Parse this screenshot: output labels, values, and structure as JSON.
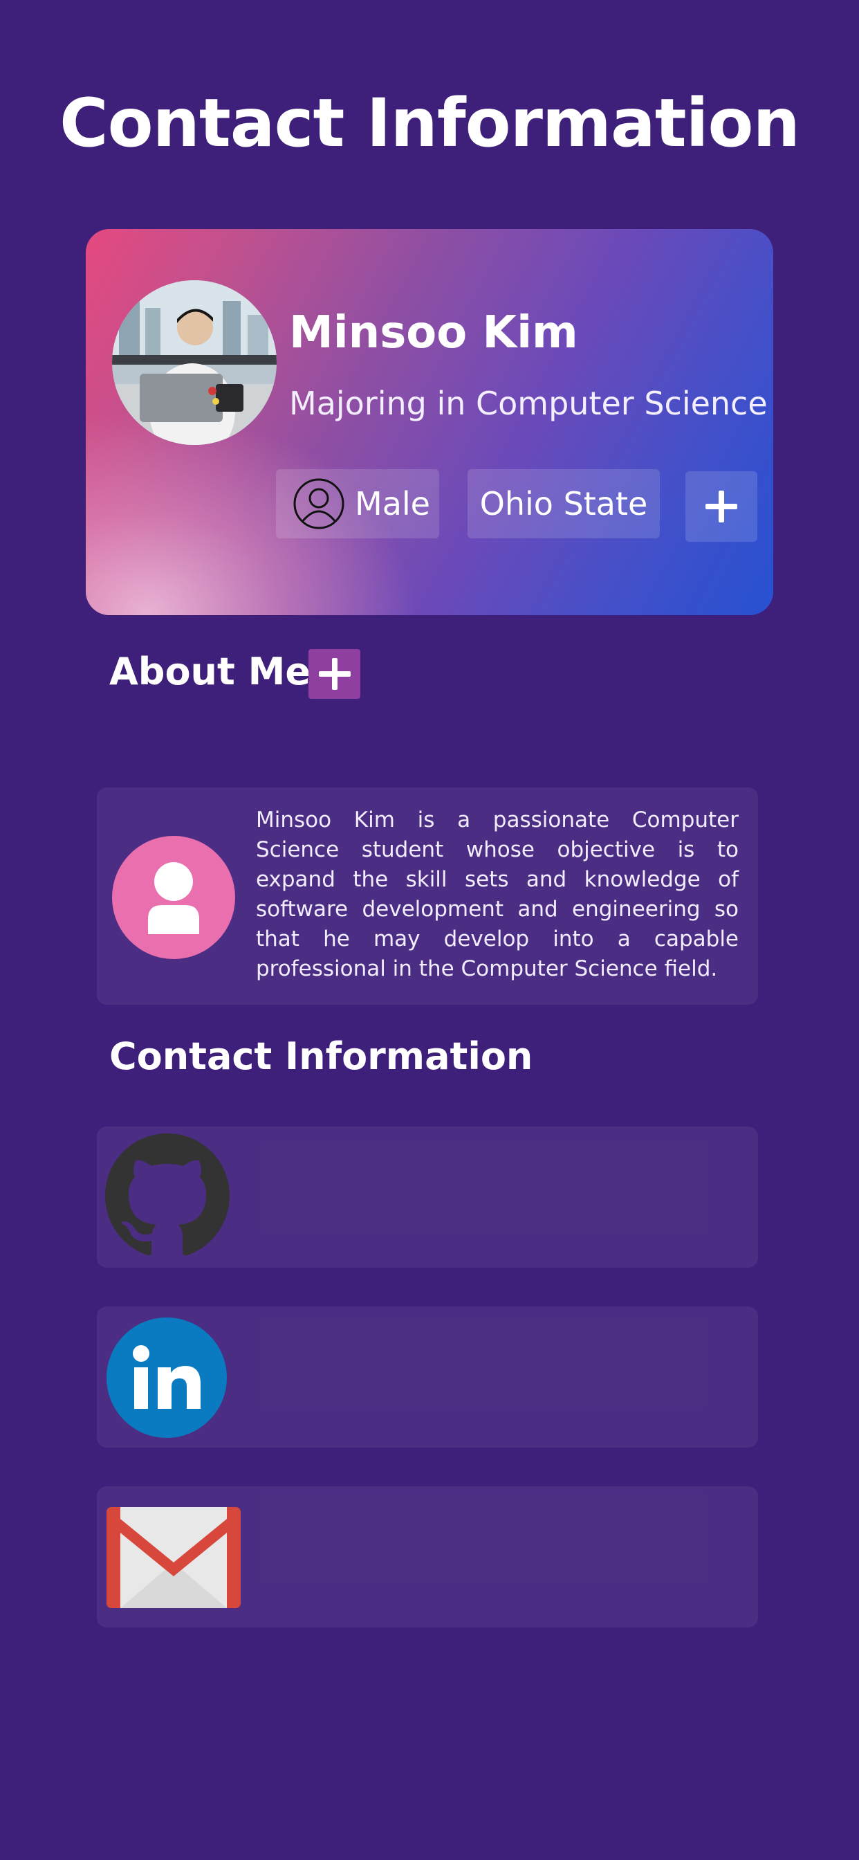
{
  "header": {
    "title": "Contact Information"
  },
  "profile": {
    "name": "Minsoo Kim",
    "major": "Majoring in Computer Science",
    "gender": "Male",
    "school": "Ohio State",
    "add_label": "+"
  },
  "about": {
    "title": "About Me",
    "add_label": "+",
    "text": "Minsoo Kim is a passionate Computer Science student whose objective is to expand the skill sets and knowledge of software development and engineering so that he may develop into a capable professional in the Computer Science field."
  },
  "contact": {
    "title": "Contact Information",
    "items": [
      {
        "icon": "github-icon"
      },
      {
        "icon": "linkedin-icon"
      },
      {
        "icon": "gmail-icon"
      }
    ]
  },
  "colors": {
    "background": "#3e1f7a",
    "card_gradient_start": "#e5497f",
    "card_gradient_end": "#2751d2",
    "about_add_button": "#8e3fa0",
    "about_avatar": "#ea6fae",
    "linkedin": "#0a7bc1",
    "gmail_red": "#d8473b"
  }
}
